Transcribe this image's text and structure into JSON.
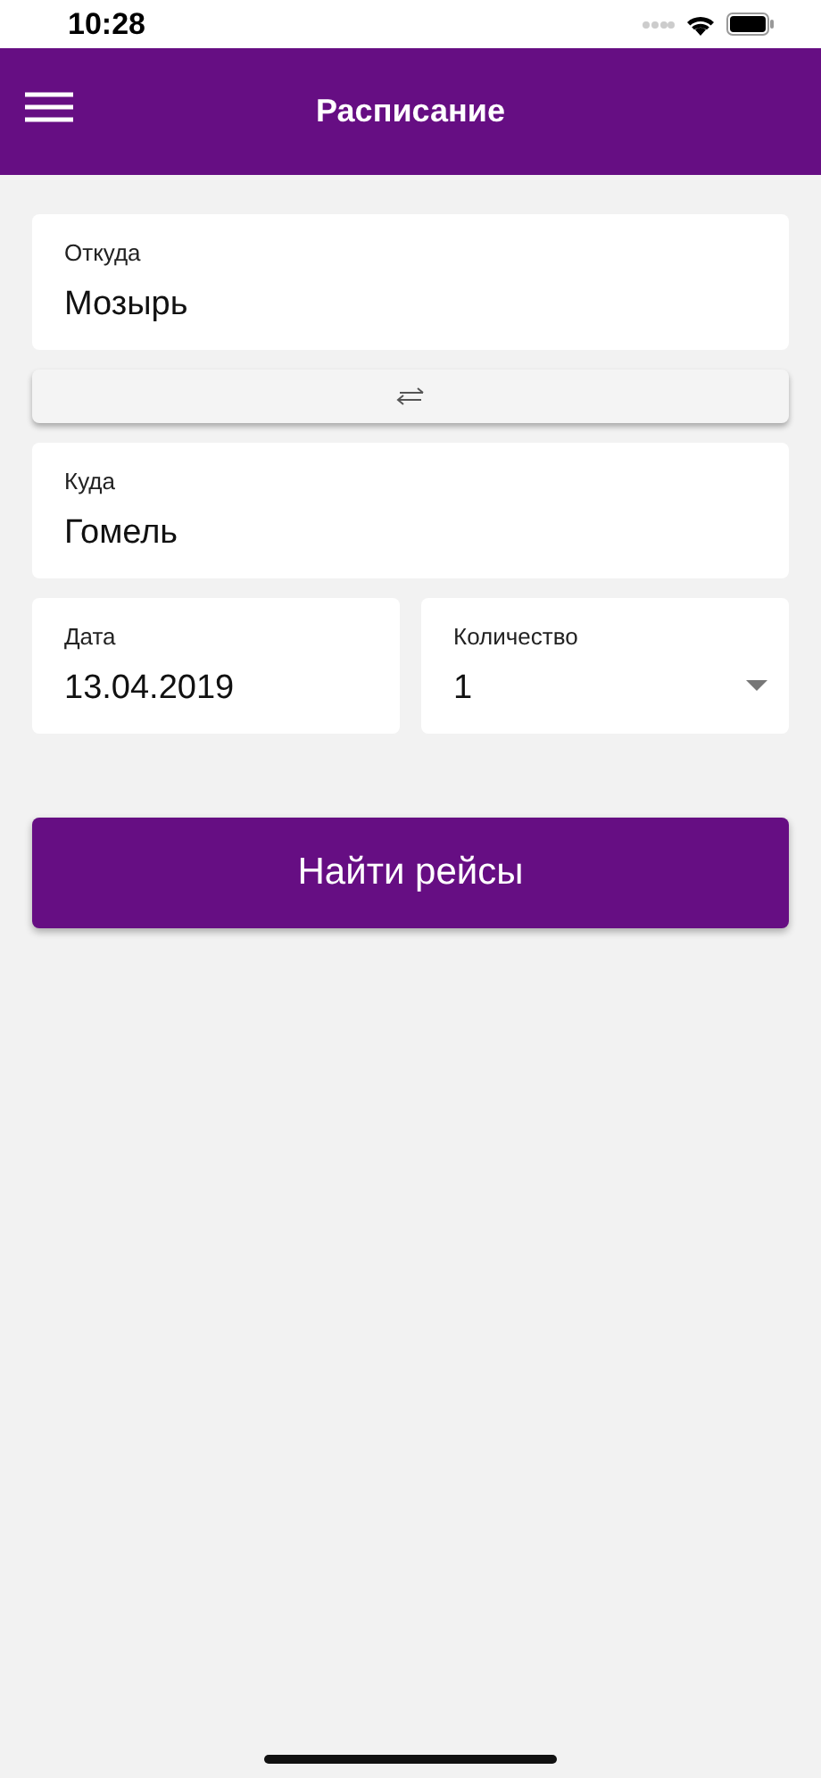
{
  "status_bar": {
    "time": "10:28"
  },
  "header": {
    "title": "Расписание"
  },
  "fields": [
    {
      "kind": "text",
      "label": "Откуда",
      "value": "Мозырь"
    },
    {
      "kind": "swap"
    },
    {
      "kind": "text",
      "label": "Куда",
      "value": "Гомель"
    }
  ],
  "row": [
    {
      "kind": "text",
      "label": "Дата",
      "value": "13.04.2019"
    },
    {
      "kind": "dropdown",
      "label": "Количество",
      "value": "1"
    }
  ],
  "search_button": {
    "label": "Найти рейсы"
  }
}
